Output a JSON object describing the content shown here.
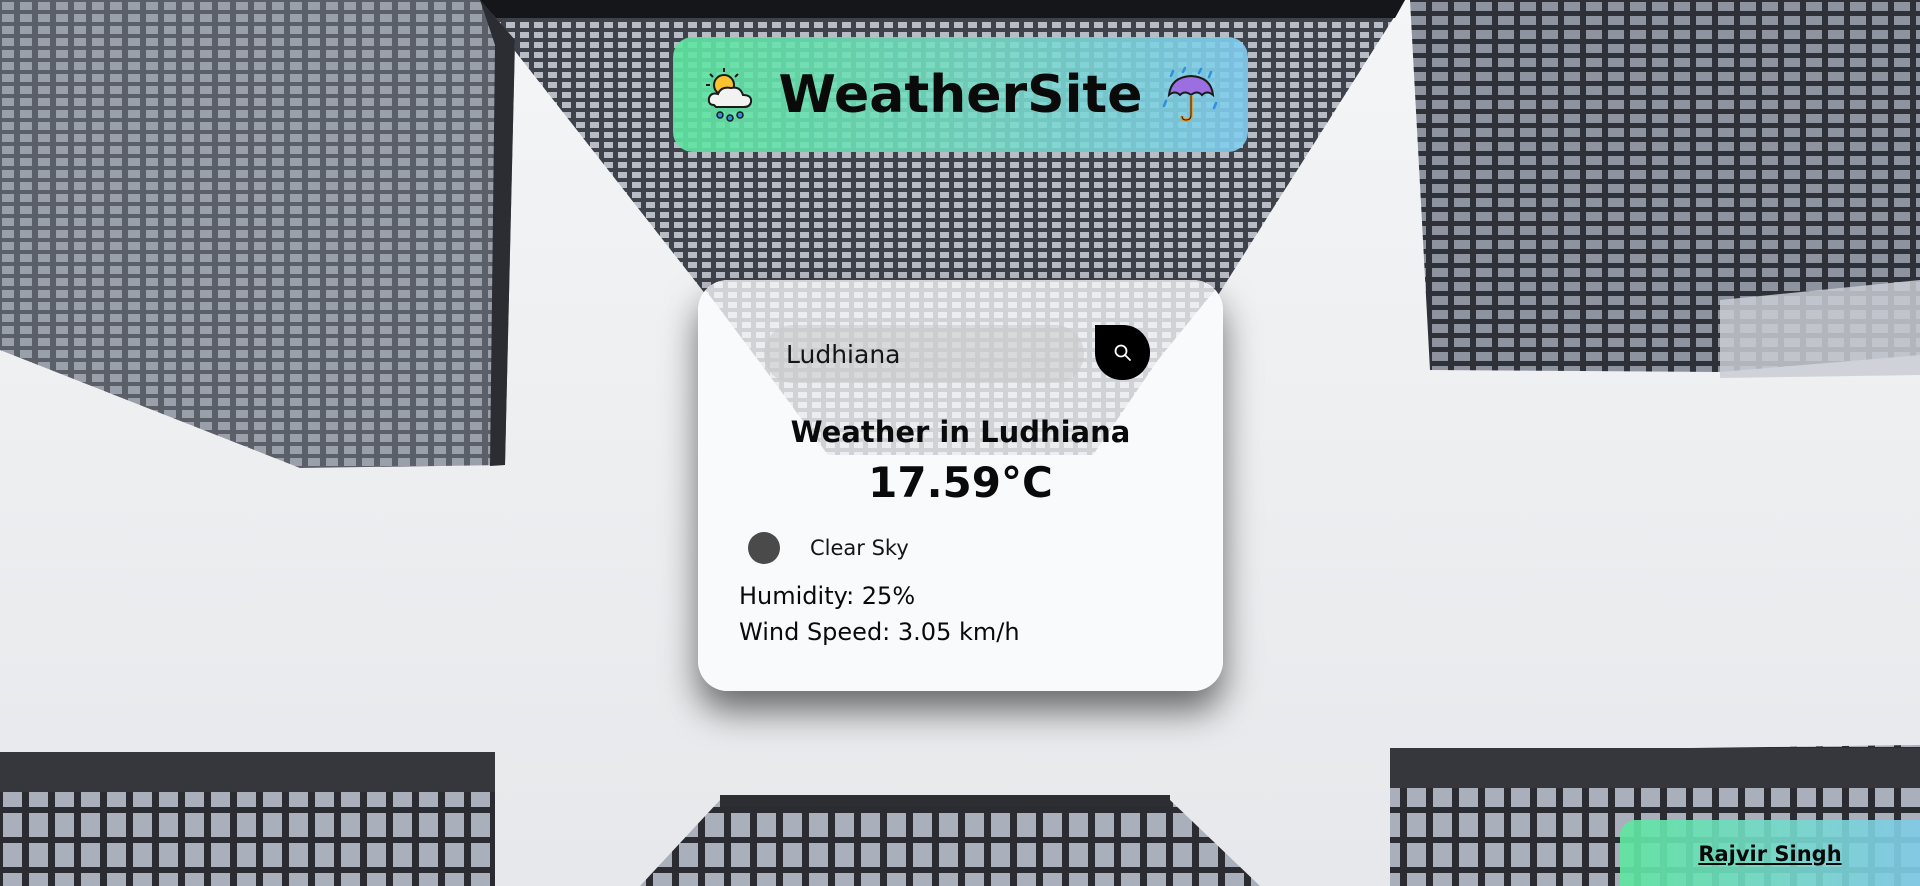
{
  "header": {
    "title": "WeatherSite",
    "left_icon": "sun-behind-rain-cloud-icon",
    "right_icon": "umbrella-with-rain-icon"
  },
  "search": {
    "value": "Ludhiana",
    "placeholder": "Ludhiana",
    "button_icon": "search-icon"
  },
  "weather": {
    "heading": "Weather in Ludhiana",
    "temperature": "17.59°C",
    "condition_icon": "weather-condition-icon",
    "condition": "Clear Sky",
    "humidity": "Humidity: 25%",
    "wind_speed": "Wind Speed: 3.05 km/h"
  },
  "footer": {
    "author": "Rajvir Singh"
  },
  "colors": {
    "banner_gradient_start": "#5fe6a0",
    "banner_gradient_end": "#82cdf0",
    "search_button": "#000000",
    "text": "#0a0a0a"
  }
}
